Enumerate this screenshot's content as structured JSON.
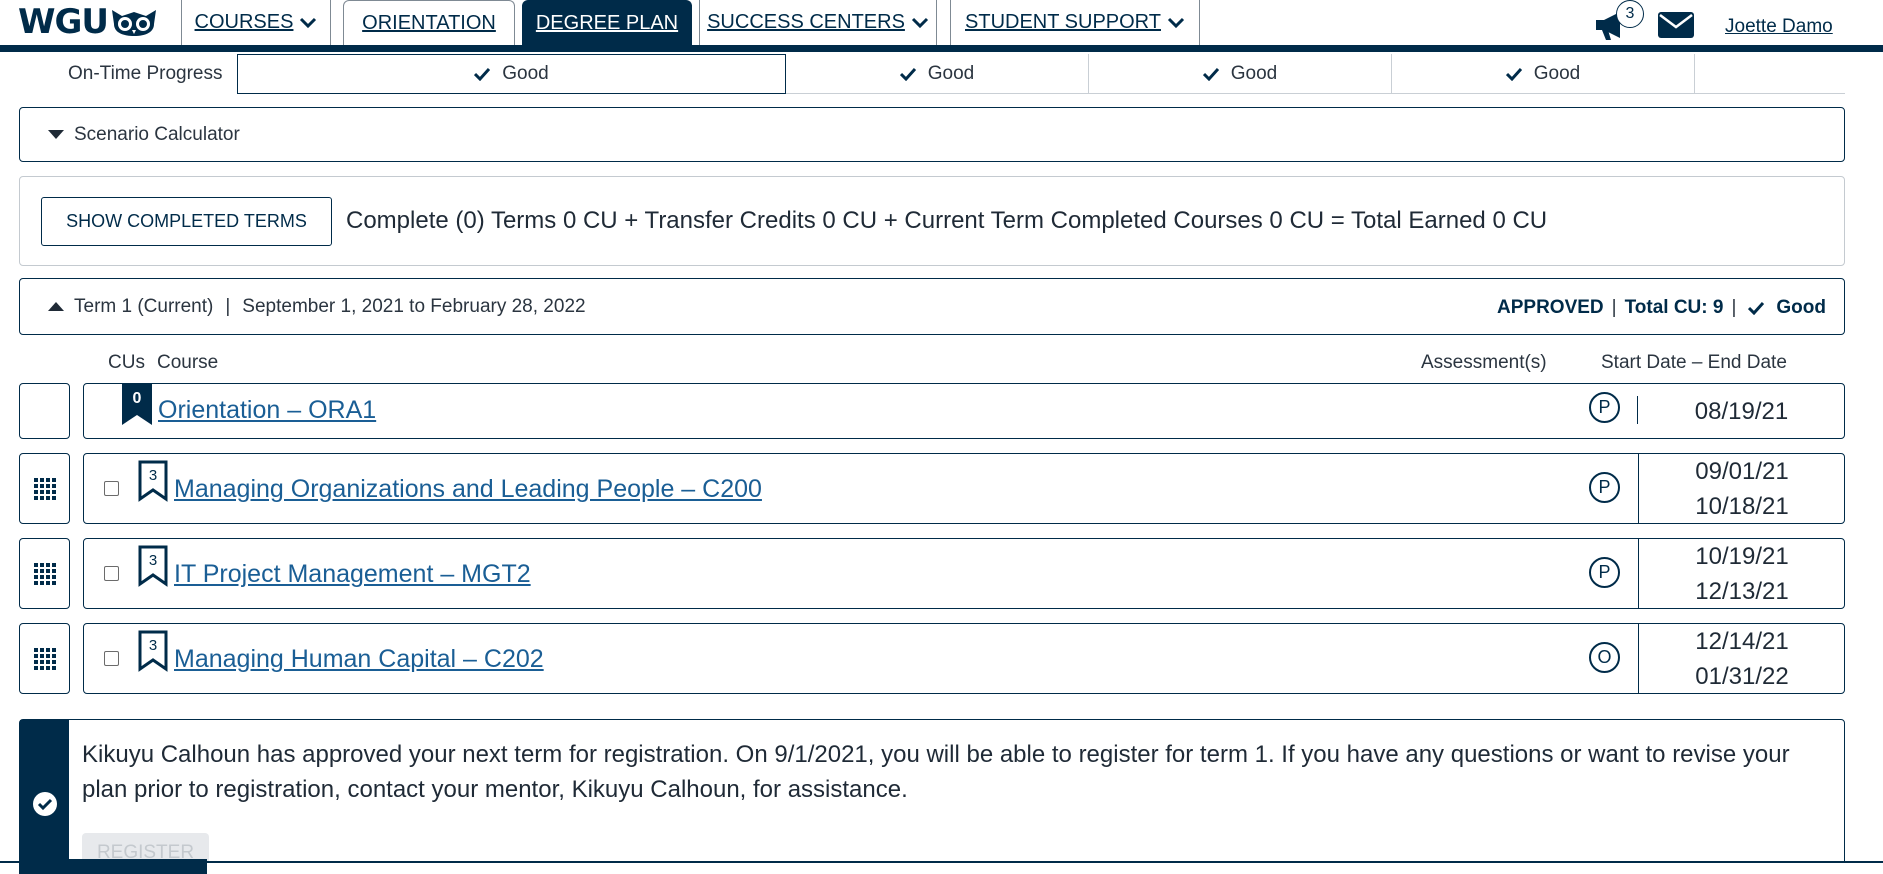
{
  "header": {
    "logo_text": "WGU",
    "nav": [
      {
        "label": "COURSES",
        "dropdown": true
      },
      {
        "label": "ORIENTATION",
        "dropdown": false
      },
      {
        "label": "DEGREE PLAN",
        "dropdown": false,
        "active": true
      },
      {
        "label": "SUCCESS CENTERS",
        "dropdown": true
      },
      {
        "label": "STUDENT SUPPORT",
        "dropdown": true
      }
    ],
    "notification_count": "3",
    "user_name": "Joette Damo"
  },
  "progress": {
    "label": "On-Time Progress",
    "cells": [
      "Good",
      "Good",
      "Good",
      "Good"
    ]
  },
  "scenario": {
    "label": "Scenario Calculator"
  },
  "completed": {
    "button_label": "SHOW COMPLETED TERMS",
    "summary": "Complete (0) Terms 0 CU + Transfer Credits 0 CU + Current Term Completed Courses 0 CU = Total Earned 0 CU"
  },
  "term": {
    "name": "Term 1 (Current)",
    "separator": "|",
    "dates": "September 1, 2021 to February 28, 2022",
    "status": "APPROVED",
    "total_cu": "Total CU: 9",
    "progress": "Good"
  },
  "columns": {
    "cus": "CUs",
    "course": "Course",
    "assessments": "Assessment(s)",
    "dates": "Start Date – End Date"
  },
  "courses": [
    {
      "cu": "0",
      "title": "Orientation – ORA1",
      "assessment": "P",
      "start": "08/19/21",
      "end": ""
    },
    {
      "cu": "3",
      "title": "Managing Organizations and Leading People – C200",
      "assessment": "P",
      "start": "09/01/21",
      "end": "10/18/21"
    },
    {
      "cu": "3",
      "title": "IT Project Management – MGT2",
      "assessment": "P",
      "start": "10/19/21",
      "end": "12/13/21"
    },
    {
      "cu": "3",
      "title": "Managing Human Capital – C202",
      "assessment": "O",
      "start": "12/14/21",
      "end": "01/31/22"
    }
  ],
  "message": {
    "text": "Kikuyu Calhoun has approved your next term for registration. On 9/1/2021, you will be able to register for term 1. If you have any questions or want to revise your plan prior to registration, contact your mentor, Kikuyu Calhoun, for assistance.",
    "button_label": "REGISTER"
  },
  "colors": {
    "brand": "#002b49",
    "link": "#1a5e95"
  },
  "icons": [
    "owl-logo-icon",
    "chevron-down-icon",
    "megaphone-icon",
    "mail-icon",
    "check-icon",
    "drag-handle-icon",
    "bookmark-icon",
    "check-circle-icon"
  ]
}
